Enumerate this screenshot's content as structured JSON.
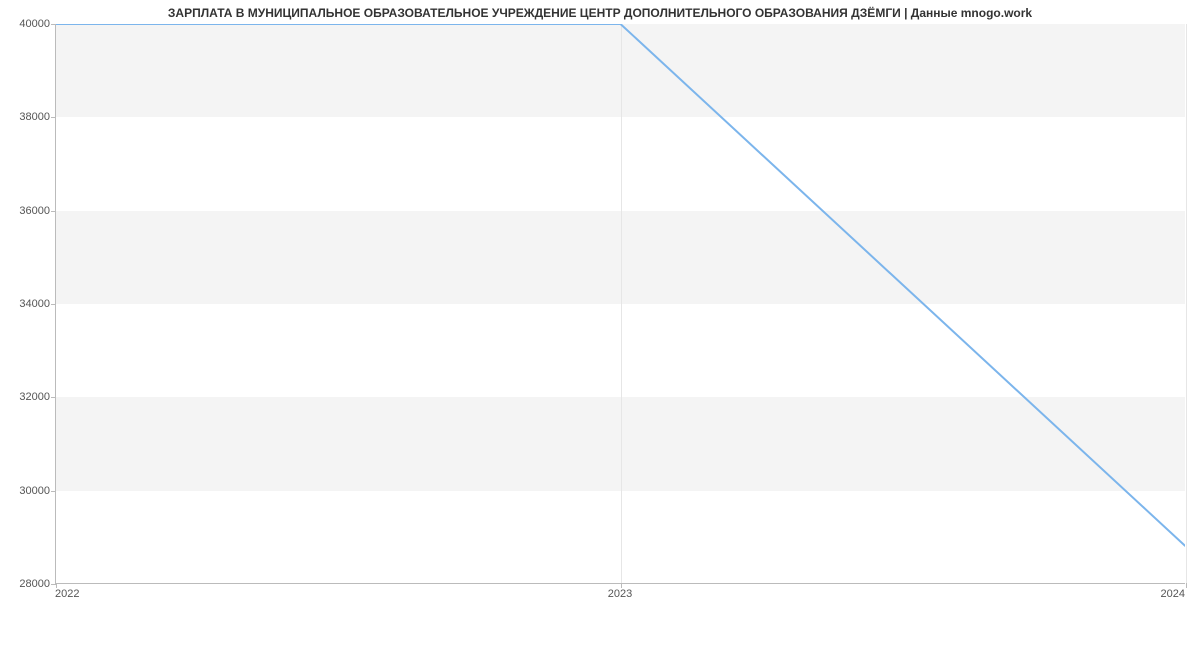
{
  "chart_data": {
    "type": "line",
    "title": "ЗАРПЛАТА В МУНИЦИПАЛЬНОЕ ОБРАЗОВАТЕЛЬНОЕ УЧРЕЖДЕНИЕ ЦЕНТР ДОПОЛНИТЕЛЬНОГО ОБРАЗОВАНИЯ ДЗЁМГИ | Данные mnogo.work",
    "x": [
      2022,
      2023,
      2024
    ],
    "series": [
      {
        "name": "salary",
        "color": "#7cb5ec",
        "values": [
          40000,
          40000,
          28800
        ]
      }
    ],
    "x_ticks": [
      2022,
      2023,
      2024
    ],
    "y_ticks": [
      28000,
      30000,
      32000,
      34000,
      36000,
      38000,
      40000
    ],
    "xlim": [
      2022,
      2024
    ],
    "ylim": [
      28000,
      40000
    ],
    "xlabel": "",
    "ylabel": "",
    "grid": {
      "alternating_bands": true,
      "vertical_lines": true
    }
  }
}
